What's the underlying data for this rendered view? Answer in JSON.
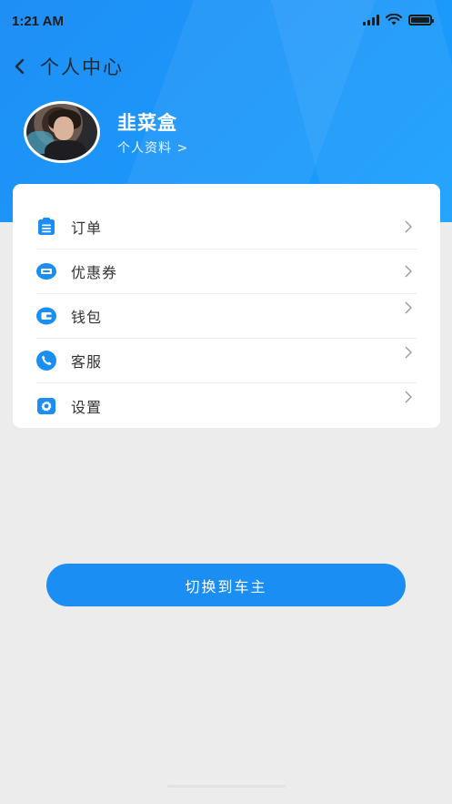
{
  "status_bar": {
    "time": "1:21 AM"
  },
  "nav": {
    "title": "个人中心"
  },
  "profile": {
    "name": "韭菜盒",
    "link_label": "个人资料 >"
  },
  "menu": {
    "items": [
      {
        "label": "订单",
        "icon": "clipboard-icon"
      },
      {
        "label": "优惠券",
        "icon": "ticket-icon"
      },
      {
        "label": "钱包",
        "icon": "wallet-icon"
      },
      {
        "label": "客服",
        "icon": "phone-icon"
      },
      {
        "label": "设置",
        "icon": "gear-icon"
      }
    ]
  },
  "switch_button": {
    "label": "切换到车主"
  },
  "colors": {
    "primary": "#1b8ef4",
    "background": "#ececec",
    "card": "#ffffff"
  }
}
